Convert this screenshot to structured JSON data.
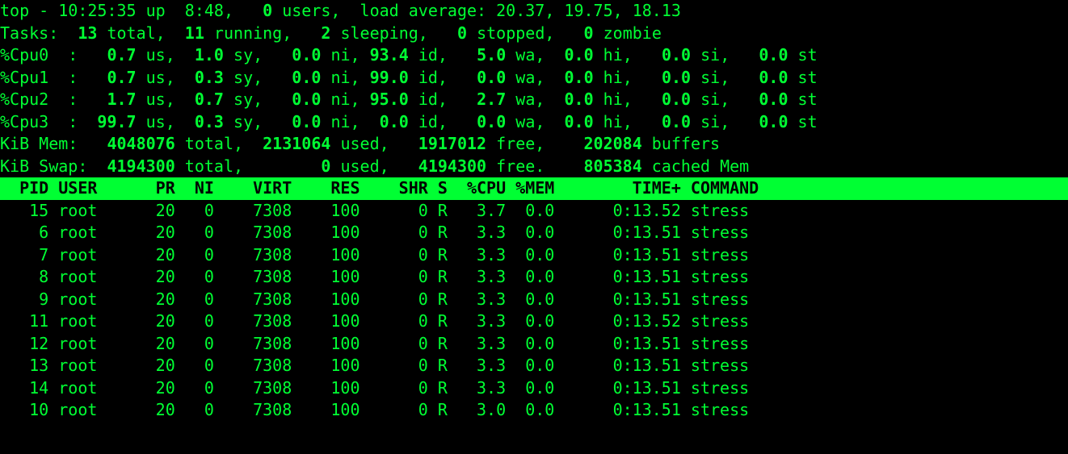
{
  "summary": {
    "time": "10:25:35",
    "uptime": "8:48",
    "users": 0,
    "load": [
      "20.37",
      "19.75",
      "18.13"
    ],
    "tasks": {
      "total": 13,
      "running": 11,
      "sleeping": 2,
      "stopped": 0,
      "zombie": 0
    },
    "cpus": [
      {
        "name": "%Cpu0",
        "us": "0.7",
        "sy": "1.0",
        "ni": "0.0",
        "id": "93.4",
        "wa": "5.0",
        "hi": "0.0",
        "si": "0.0",
        "st": "0.0"
      },
      {
        "name": "%Cpu1",
        "us": "0.7",
        "sy": "0.3",
        "ni": "0.0",
        "id": "99.0",
        "wa": "0.0",
        "hi": "0.0",
        "si": "0.0",
        "st": "0.0"
      },
      {
        "name": "%Cpu2",
        "us": "1.7",
        "sy": "0.7",
        "ni": "0.0",
        "id": "95.0",
        "wa": "2.7",
        "hi": "0.0",
        "si": "0.0",
        "st": "0.0"
      },
      {
        "name": "%Cpu3",
        "us": "99.7",
        "sy": "0.3",
        "ni": "0.0",
        "id": "0.0",
        "wa": "0.0",
        "hi": "0.0",
        "si": "0.0",
        "st": "0.0"
      }
    ],
    "mem": {
      "label": "KiB Mem:",
      "total": "4048076",
      "used": "2131064",
      "free": "1917012",
      "extra_val": "202084",
      "extra_lbl": "buffers"
    },
    "swap": {
      "label": "KiB Swap:",
      "total": "4194300",
      "used": "0",
      "free": "4194300",
      "extra_val": "805384",
      "extra_lbl": "cached Mem"
    }
  },
  "columns": [
    "PID",
    "USER",
    "PR",
    "NI",
    "VIRT",
    "RES",
    "SHR",
    "S",
    "%CPU",
    "%MEM",
    "TIME+",
    "COMMAND"
  ],
  "processes": [
    {
      "pid": 15,
      "user": "root",
      "pr": 20,
      "ni": 0,
      "virt": 7308,
      "res": 100,
      "shr": 0,
      "s": "R",
      "cpu": "3.7",
      "mem": "0.0",
      "time": "0:13.52",
      "cmd": "stress"
    },
    {
      "pid": 6,
      "user": "root",
      "pr": 20,
      "ni": 0,
      "virt": 7308,
      "res": 100,
      "shr": 0,
      "s": "R",
      "cpu": "3.3",
      "mem": "0.0",
      "time": "0:13.51",
      "cmd": "stress"
    },
    {
      "pid": 7,
      "user": "root",
      "pr": 20,
      "ni": 0,
      "virt": 7308,
      "res": 100,
      "shr": 0,
      "s": "R",
      "cpu": "3.3",
      "mem": "0.0",
      "time": "0:13.51",
      "cmd": "stress"
    },
    {
      "pid": 8,
      "user": "root",
      "pr": 20,
      "ni": 0,
      "virt": 7308,
      "res": 100,
      "shr": 0,
      "s": "R",
      "cpu": "3.3",
      "mem": "0.0",
      "time": "0:13.51",
      "cmd": "stress"
    },
    {
      "pid": 9,
      "user": "root",
      "pr": 20,
      "ni": 0,
      "virt": 7308,
      "res": 100,
      "shr": 0,
      "s": "R",
      "cpu": "3.3",
      "mem": "0.0",
      "time": "0:13.51",
      "cmd": "stress"
    },
    {
      "pid": 11,
      "user": "root",
      "pr": 20,
      "ni": 0,
      "virt": 7308,
      "res": 100,
      "shr": 0,
      "s": "R",
      "cpu": "3.3",
      "mem": "0.0",
      "time": "0:13.52",
      "cmd": "stress"
    },
    {
      "pid": 12,
      "user": "root",
      "pr": 20,
      "ni": 0,
      "virt": 7308,
      "res": 100,
      "shr": 0,
      "s": "R",
      "cpu": "3.3",
      "mem": "0.0",
      "time": "0:13.51",
      "cmd": "stress"
    },
    {
      "pid": 13,
      "user": "root",
      "pr": 20,
      "ni": 0,
      "virt": 7308,
      "res": 100,
      "shr": 0,
      "s": "R",
      "cpu": "3.3",
      "mem": "0.0",
      "time": "0:13.51",
      "cmd": "stress"
    },
    {
      "pid": 14,
      "user": "root",
      "pr": 20,
      "ni": 0,
      "virt": 7308,
      "res": 100,
      "shr": 0,
      "s": "R",
      "cpu": "3.3",
      "mem": "0.0",
      "time": "0:13.51",
      "cmd": "stress"
    },
    {
      "pid": 10,
      "user": "root",
      "pr": 20,
      "ni": 0,
      "virt": 7308,
      "res": 100,
      "shr": 0,
      "s": "R",
      "cpu": "3.0",
      "mem": "0.0",
      "time": "0:13.51",
      "cmd": "stress"
    }
  ]
}
